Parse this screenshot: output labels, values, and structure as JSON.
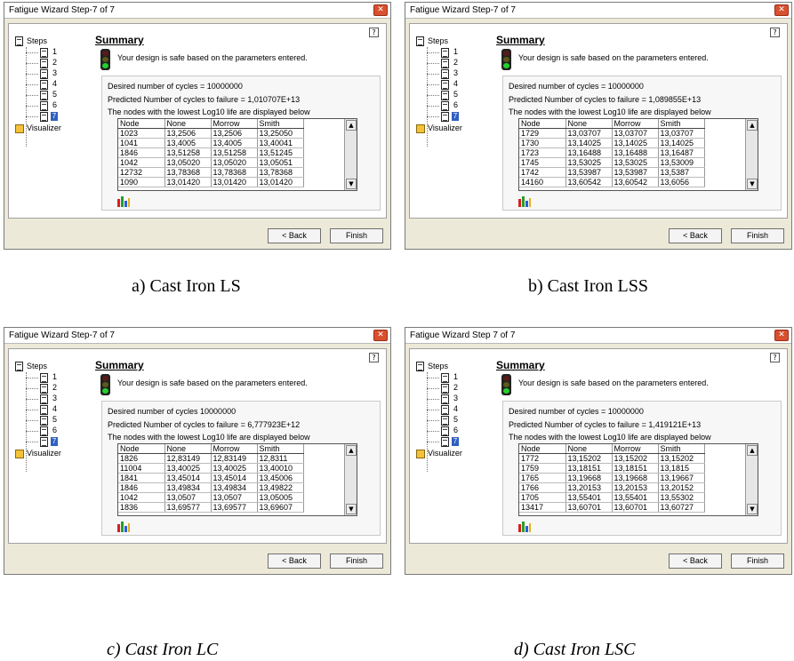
{
  "windows": [
    {
      "title": "Fatigue Wizard Step-7 of 7",
      "tree": {
        "root": "Steps",
        "steps": [
          "1",
          "2",
          "3",
          "4",
          "5",
          "6"
        ],
        "current": "7",
        "visualizer": "Visualizer"
      },
      "heading": "Summary",
      "safe_message": "Your design is safe based on the parameters entered.",
      "desired_cycles": "Desired number of cycles = 10000000",
      "predicted_cycles": "Predicted Number of cycles to failure = 1,010707E+13",
      "nodes_note": "The nodes with the lowest Log10 life are displayed below",
      "table": {
        "headers": [
          "Node",
          "None",
          "Morrow",
          "Smith"
        ],
        "rows": [
          [
            "1023",
            "13,2506",
            "13,2506",
            "13,25050"
          ],
          [
            "1041",
            "13,4005",
            "13,4005",
            "13,40041"
          ],
          [
            "1846",
            "13,51258",
            "13,51258",
            "13,51245"
          ],
          [
            "1042",
            "13,05020",
            "13,05020",
            "13,05051"
          ],
          [
            "12732",
            "13,78368",
            "13,78368",
            "13,78368"
          ],
          [
            "1090",
            "13,01420",
            "13,01420",
            "13,01420"
          ]
        ]
      },
      "buttons": {
        "back": "< Back",
        "finish": "Finish"
      },
      "caption": "a) Cast Iron LS"
    },
    {
      "title": "Fatigue Wizard Step-7 of 7",
      "tree": {
        "root": "Steps",
        "steps": [
          "1",
          "2",
          "3",
          "4",
          "5",
          "6"
        ],
        "current": "7",
        "visualizer": "Visualizer"
      },
      "heading": "Summary",
      "safe_message": "Your design is safe based on the parameters entered.",
      "desired_cycles": "Desired number of cycles = 10000000",
      "predicted_cycles": "Predicted Number of cycles to failure = 1,089855E+13",
      "nodes_note": "The nodes with the lowest Log10 life are displayed below",
      "table": {
        "headers": [
          "Node",
          "None",
          "Morrow",
          "Smith"
        ],
        "rows": [
          [
            "1729",
            "13,03707",
            "13,03707",
            "13,03707"
          ],
          [
            "1730",
            "13,14025",
            "13,14025",
            "13,14025"
          ],
          [
            "1723",
            "13,16488",
            "13,16488",
            "13,16487"
          ],
          [
            "1745",
            "13,53025",
            "13,53025",
            "13,53009"
          ],
          [
            "1742",
            "13,53987",
            "13,53987",
            "13,5387"
          ],
          [
            "14160",
            "13,60542",
            "13,60542",
            "13,6056"
          ]
        ]
      },
      "buttons": {
        "back": "< Back",
        "finish": "Finish"
      },
      "caption": "b) Cast Iron LSS"
    },
    {
      "title": "Fatigue Wizard Step-7 of 7",
      "tree": {
        "root": "Steps",
        "steps": [
          "1",
          "2",
          "3",
          "4",
          "5",
          "6"
        ],
        "current": "7",
        "visualizer": "Visualizer"
      },
      "heading": "Summary",
      "safe_message": "Your design is safe based on the parameters entered.",
      "desired_cycles": "Desired number of cycles 10000000",
      "predicted_cycles": "Predicted Number of cycles to failure = 6,777923E+12",
      "nodes_note": "The nodes with the lowest Log10 life are displayed below",
      "table": {
        "headers": [
          "Node",
          "None",
          "Morrow",
          "Smith"
        ],
        "rows": [
          [
            "1826",
            "12,83149",
            "12,83149",
            "12,8311"
          ],
          [
            "11004",
            "13,40025",
            "13,40025",
            "13,40010"
          ],
          [
            "1841",
            "13,45014",
            "13,45014",
            "13,45006"
          ],
          [
            "1846",
            "13,49834",
            "13,49834",
            "13,49822"
          ],
          [
            "1042",
            "13,0507",
            "13,0507",
            "13,05005"
          ],
          [
            "1836",
            "13,69577",
            "13,69577",
            "13,69607"
          ]
        ]
      },
      "buttons": {
        "back": "< Back",
        "finish": "Finish"
      },
      "caption": "c) Cast Iron LC"
    },
    {
      "title": "Fatigue Wizard Step 7 of 7",
      "tree": {
        "root": "Steps",
        "steps": [
          "1",
          "2",
          "3",
          "4",
          "5",
          "6"
        ],
        "current": "7",
        "visualizer": "Visualizer"
      },
      "heading": "Summary",
      "safe_message": "Your design is safe based on the parameters entered.",
      "desired_cycles": "Desired number of cycles = 10000000",
      "predicted_cycles": "Predicted Number of cycles to failure = 1,419121E+13",
      "nodes_note": "The nodes with the lowest Log10 life are displayed below",
      "table": {
        "headers": [
          "Node",
          "None",
          "Morrow",
          "Smith"
        ],
        "rows": [
          [
            "1772",
            "13,15202",
            "13,15202",
            "13,15202"
          ],
          [
            "1759",
            "13,18151",
            "13,18151",
            "13,1815"
          ],
          [
            "1765",
            "13,19668",
            "13,19668",
            "13,19667"
          ],
          [
            "1766",
            "13,20153",
            "13,20153",
            "13,20152"
          ],
          [
            "1705",
            "13,55401",
            "13,55401",
            "13,55302"
          ],
          [
            "13417",
            "13,60701",
            "13,60701",
            "13,60727"
          ]
        ]
      },
      "buttons": {
        "back": "< Back",
        "finish": "Finish"
      },
      "caption": "d) Cast Iron LSC"
    }
  ],
  "icons": {
    "close": "close-icon",
    "help": "help-icon",
    "traffic_light": "traffic-light-icon",
    "chart": "bar-chart-icon",
    "document": "document-icon",
    "visualizer": "visualizer-icon"
  },
  "colors": {
    "green_light": "#23d12c",
    "close_button": "#d8502e",
    "chart_bars": [
      "#d62020",
      "#2a9d2a",
      "#2a5ed6",
      "#e8b020"
    ]
  }
}
